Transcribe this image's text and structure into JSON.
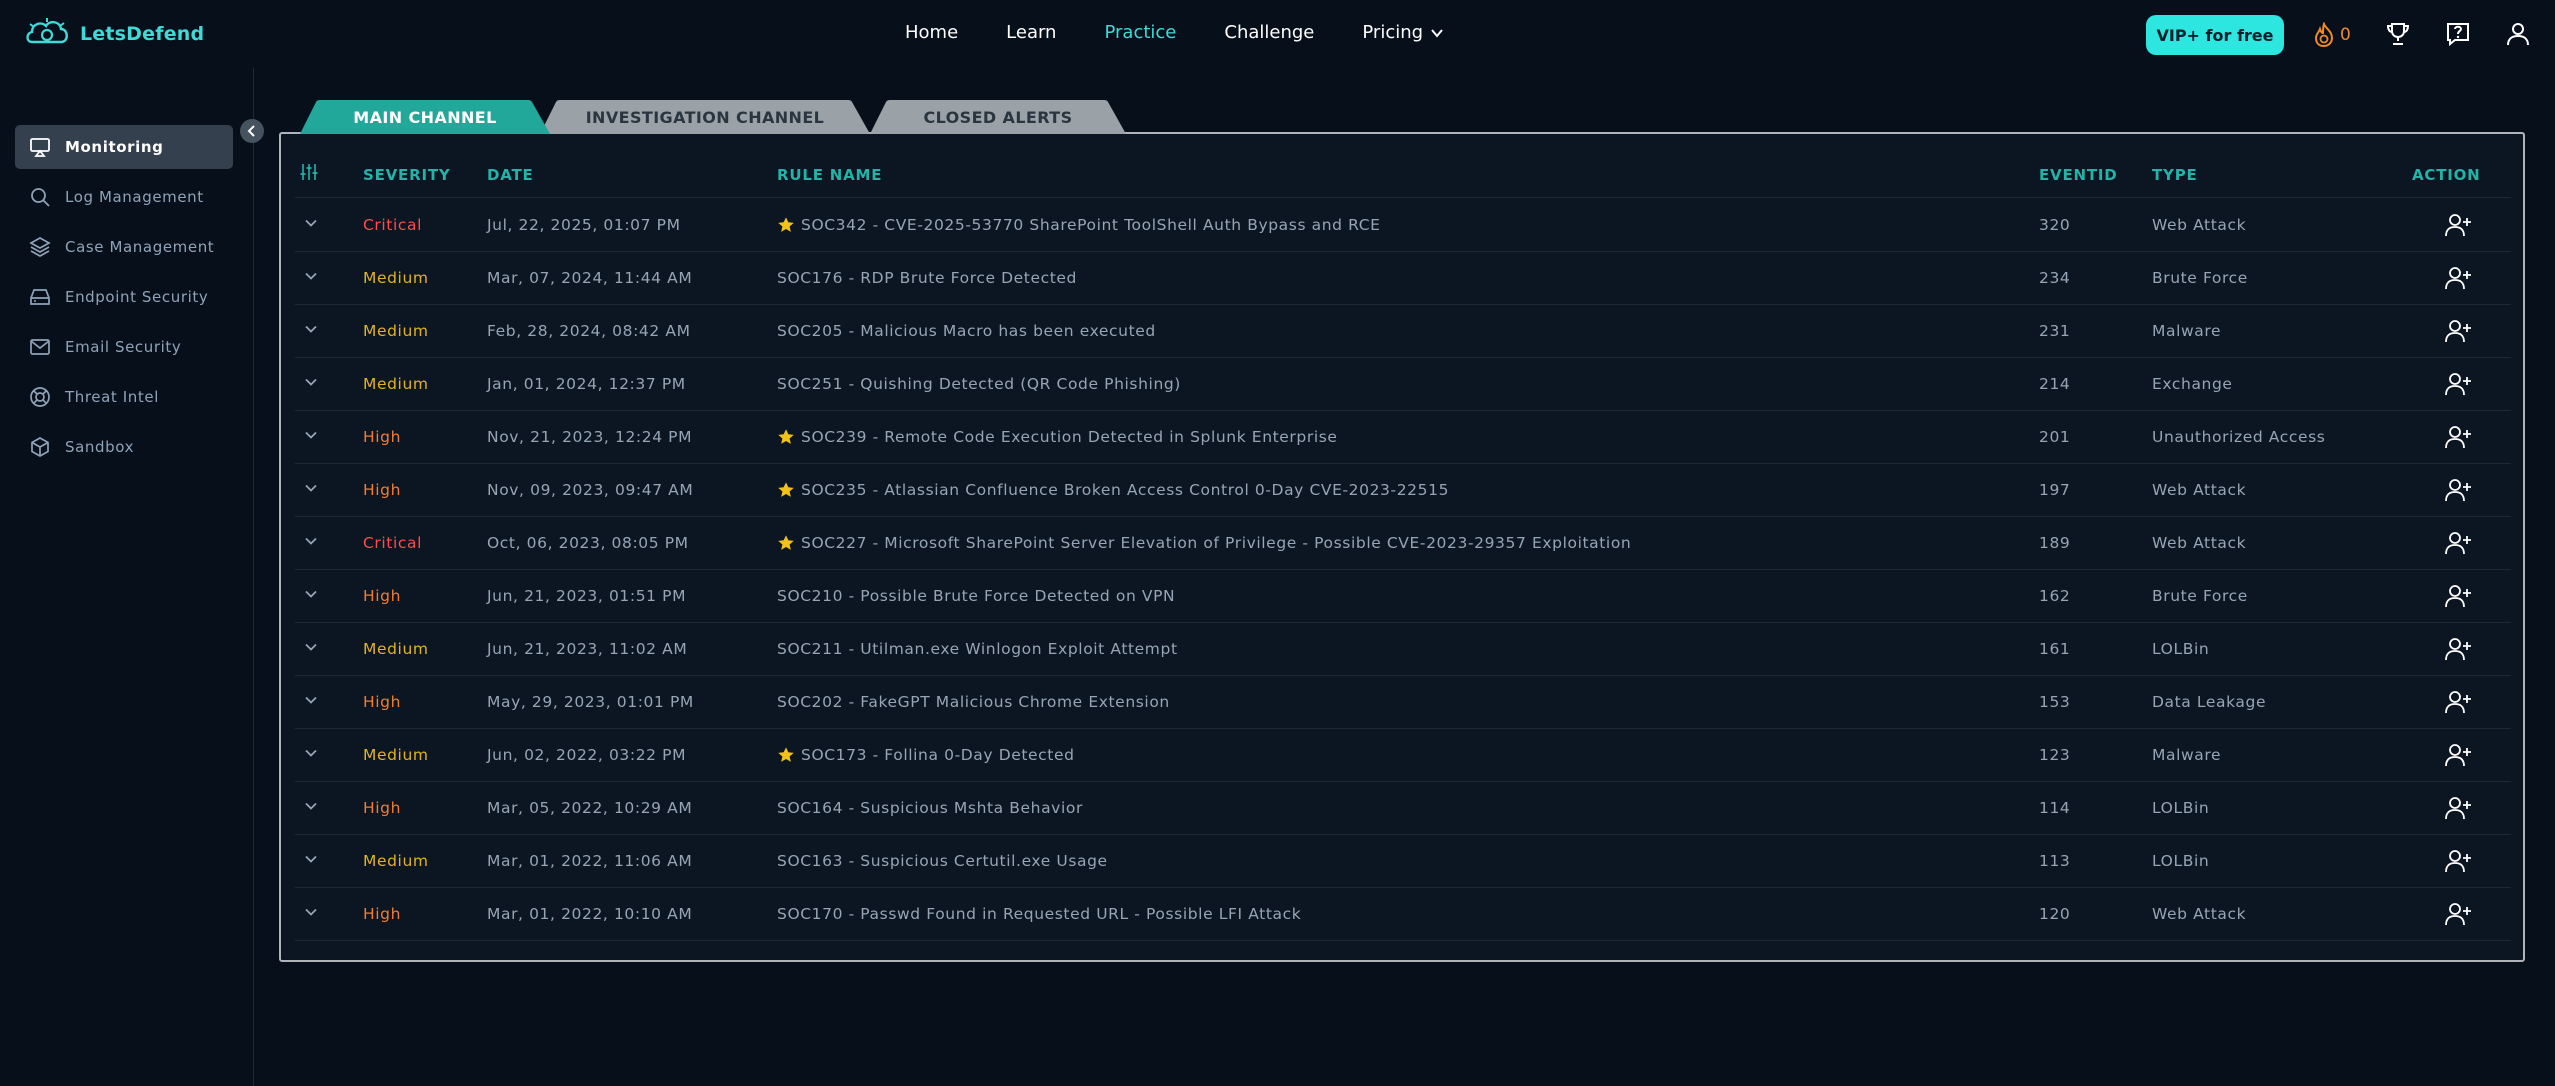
{
  "app": {
    "name": "LetsDefend"
  },
  "nav": {
    "items": [
      {
        "label": "Home",
        "active": false
      },
      {
        "label": "Learn",
        "active": false
      },
      {
        "label": "Practice",
        "active": true
      },
      {
        "label": "Challenge",
        "active": false
      },
      {
        "label": "Pricing",
        "active": false,
        "dropdown": true
      }
    ],
    "vip_label": "VIP+ for free",
    "streak_count": "0",
    "icons": [
      "fire-icon",
      "trophy-icon",
      "help-icon",
      "user-icon"
    ]
  },
  "sidebar": {
    "items": [
      {
        "label": "Monitoring",
        "icon": "monitor-icon",
        "active": true
      },
      {
        "label": "Log Management",
        "icon": "search-icon",
        "active": false
      },
      {
        "label": "Case Management",
        "icon": "layers-icon",
        "active": false
      },
      {
        "label": "Endpoint Security",
        "icon": "hard-drive-icon",
        "active": false
      },
      {
        "label": "Email Security",
        "icon": "mail-icon",
        "active": false
      },
      {
        "label": "Threat Intel",
        "icon": "lifebuoy-icon",
        "active": false
      },
      {
        "label": "Sandbox",
        "icon": "box-icon",
        "active": false
      }
    ]
  },
  "tabs": [
    {
      "label": "MAIN CHANNEL",
      "active": true
    },
    {
      "label": "INVESTIGATION CHANNEL",
      "active": false
    },
    {
      "label": "CLOSED ALERTS",
      "active": false
    }
  ],
  "table": {
    "headers": {
      "severity": "SEVERITY",
      "date": "DATE",
      "rule": "RULE NAME",
      "eventid": "EVENTID",
      "type": "TYPE",
      "action": "ACTION"
    },
    "rows": [
      {
        "severity": "Critical",
        "date": "Jul, 22, 2025, 01:07 PM",
        "rule": "SOC342 - CVE-2025-53770 SharePoint ToolShell Auth Bypass and RCE",
        "starred": true,
        "eventid": "320",
        "type": "Web Attack"
      },
      {
        "severity": "Medium",
        "date": "Mar, 07, 2024, 11:44 AM",
        "rule": "SOC176 - RDP Brute Force Detected",
        "starred": false,
        "eventid": "234",
        "type": "Brute Force"
      },
      {
        "severity": "Medium",
        "date": "Feb, 28, 2024, 08:42 AM",
        "rule": "SOC205 - Malicious Macro has been executed",
        "starred": false,
        "eventid": "231",
        "type": "Malware"
      },
      {
        "severity": "Medium",
        "date": "Jan, 01, 2024, 12:37 PM",
        "rule": "SOC251 - Quishing Detected (QR Code Phishing)",
        "starred": false,
        "eventid": "214",
        "type": "Exchange"
      },
      {
        "severity": "High",
        "date": "Nov, 21, 2023, 12:24 PM",
        "rule": "SOC239 - Remote Code Execution Detected in Splunk Enterprise",
        "starred": true,
        "eventid": "201",
        "type": "Unauthorized Access"
      },
      {
        "severity": "High",
        "date": "Nov, 09, 2023, 09:47 AM",
        "rule": "SOC235 - Atlassian Confluence Broken Access Control 0-Day CVE-2023-22515",
        "starred": true,
        "eventid": "197",
        "type": "Web Attack"
      },
      {
        "severity": "Critical",
        "date": "Oct, 06, 2023, 08:05 PM",
        "rule": "SOC227 - Microsoft SharePoint Server Elevation of Privilege - Possible CVE-2023-29357 Exploitation",
        "starred": true,
        "eventid": "189",
        "type": "Web Attack"
      },
      {
        "severity": "High",
        "date": "Jun, 21, 2023, 01:51 PM",
        "rule": "SOC210 - Possible Brute Force Detected on VPN",
        "starred": false,
        "eventid": "162",
        "type": "Brute Force"
      },
      {
        "severity": "Medium",
        "date": "Jun, 21, 2023, 11:02 AM",
        "rule": "SOC211 - Utilman.exe Winlogon Exploit Attempt",
        "starred": false,
        "eventid": "161",
        "type": "LOLBin"
      },
      {
        "severity": "High",
        "date": "May, 29, 2023, 01:01 PM",
        "rule": "SOC202 - FakeGPT Malicious Chrome Extension",
        "starred": false,
        "eventid": "153",
        "type": "Data Leakage"
      },
      {
        "severity": "Medium",
        "date": "Jun, 02, 2022, 03:22 PM",
        "rule": "SOC173 - Follina 0-Day Detected",
        "starred": true,
        "eventid": "123",
        "type": "Malware"
      },
      {
        "severity": "High",
        "date": "Mar, 05, 2022, 10:29 AM",
        "rule": "SOC164 - Suspicious Mshta Behavior",
        "starred": false,
        "eventid": "114",
        "type": "LOLBin"
      },
      {
        "severity": "Medium",
        "date": "Mar, 01, 2022, 11:06 AM",
        "rule": "SOC163 - Suspicious Certutil.exe Usage",
        "starred": false,
        "eventid": "113",
        "type": "LOLBin"
      },
      {
        "severity": "High",
        "date": "Mar, 01, 2022, 10:10 AM",
        "rule": "SOC170 - Passwd Found in Requested URL - Possible LFI Attack",
        "starred": false,
        "eventid": "120",
        "type": "Web Attack"
      }
    ]
  },
  "colors": {
    "accent": "#3ddad7",
    "critical": "#ff4b4b",
    "high": "#f47c2e",
    "medium": "#e2b321",
    "header_text": "#23b3a7"
  }
}
